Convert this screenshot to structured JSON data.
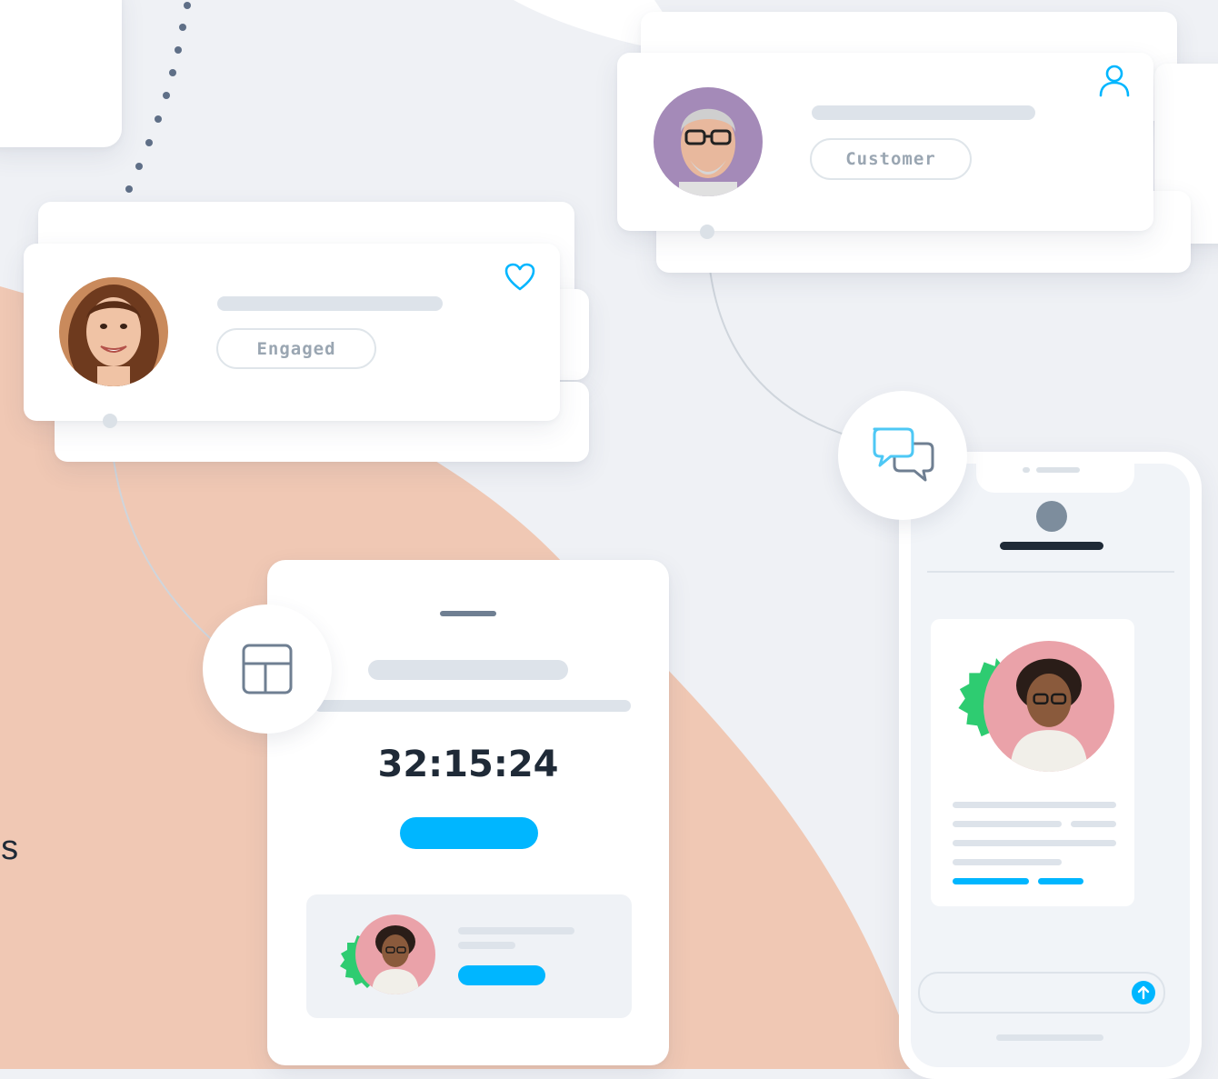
{
  "engaged_card": {
    "badge_label": "Engaged",
    "icon": "heart-icon",
    "avatar": "woman-portrait"
  },
  "customer_card": {
    "badge_label": "Customer",
    "icon": "user-icon",
    "avatar": "man-with-glasses-portrait"
  },
  "timer_card": {
    "countdown": "32:15:24",
    "icon": "layout-icon"
  },
  "phone": {
    "chat_icon": "chat-bubbles-icon",
    "send_icon": "arrow-up-icon"
  },
  "partial_text": "os",
  "colors": {
    "background": "#eff1f5",
    "peach": "#f0c8b4",
    "accent_blue": "#00b6ff",
    "badge_green": "#2ecc71",
    "placeholder_grey": "#dde3ea",
    "dark_text": "#1f2a37"
  }
}
